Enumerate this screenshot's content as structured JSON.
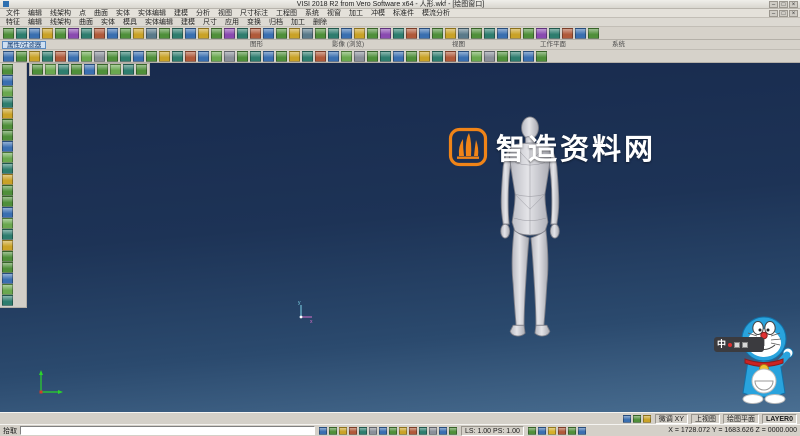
{
  "window": {
    "title": "VISI 2018 R2 from Vero Software x64 - 人形.wkf - [绘图窗口]",
    "controls": {
      "minimize": "–",
      "maximize": "□",
      "close": "×"
    }
  },
  "menus": {
    "main": [
      "文件",
      "编辑",
      "线架构",
      "点",
      "曲面",
      "实体",
      "实体编辑",
      "建模",
      "分析",
      "视图",
      "尺寸标注",
      "工程图",
      "系统",
      "视窗",
      "加工",
      "冲模",
      "标准件",
      "模流分析"
    ],
    "secondary": [
      "特征",
      "编辑",
      "线架构",
      "曲面",
      "实体",
      "模具",
      "实体编辑",
      "建模",
      "尺寸",
      "应用",
      "变换",
      "归档",
      "加工",
      "删除"
    ]
  },
  "toolbar": {
    "filter_tab": "属性/过滤器",
    "group_labels": [
      "图形",
      "影像 (浏览)",
      "视图",
      "工作平面",
      "系统"
    ],
    "row_a": {
      "count": 46,
      "size": 11,
      "name": "toolbar-icon",
      "palette": [
        "#4f8f3a",
        "#2e7d6e",
        "#3a6fb0",
        "#c9a227",
        "#4f8f3a",
        "#8a4ab0",
        "#2e7d6e",
        "#b05a3a",
        "#3a6fb0",
        "#4f8f3a",
        "#c9a227",
        "#5a7a8a"
      ]
    },
    "row_b": {
      "count": 42,
      "size": 11,
      "name": "toolbar-icon",
      "palette": [
        "#3a6fb0",
        "#4f8f3a",
        "#c9a227",
        "#2e7d6e",
        "#b05a3a",
        "#3a6fb0",
        "#6aa84f",
        "#8a8f98",
        "#4f8f3a",
        "#2e7d6e"
      ]
    },
    "row_c": {
      "count": 9,
      "size": 11,
      "name": "toolbar-icon",
      "palette": [
        "#4f8f3a",
        "#6aa84f",
        "#2e7d6e",
        "#4f8f3a",
        "#3a6fb0"
      ]
    },
    "left": {
      "count": 22,
      "size": 11,
      "name": "left-toolbar-icon",
      "palette": [
        "#4f8f3a",
        "#3a6fb0",
        "#6aa84f",
        "#2e7d6e",
        "#c9a227",
        "#4f8f3a"
      ]
    }
  },
  "viewport": {
    "watermark_text": "智造资料网",
    "watermark_accent": "#f08418"
  },
  "ime": {
    "label": "中"
  },
  "statusbar": {
    "upper_icons": {
      "count": 3,
      "size": 8,
      "name": "status-icon",
      "palette": [
        "#3a6fb0",
        "#4f8f3a",
        "#c9a227"
      ]
    },
    "snap_label": "微调 XY",
    "view_label": "上视图",
    "plane_label": "绘图平面",
    "layer": "LAYER0",
    "pick_label": "拾取",
    "scale": "LS: 1.00  PS: 1.00",
    "coords": "X = 1728.072   Y = 1683.626   Z = 0000.000",
    "lower_icons_1": {
      "count": 14,
      "size": 8,
      "name": "status-icon",
      "palette": [
        "#3a6fb0",
        "#4f8f3a",
        "#c9a227",
        "#b05a3a",
        "#2e7d6e",
        "#8a8f98"
      ]
    },
    "lower_icons_2": {
      "count": 6,
      "size": 8,
      "name": "status-icon",
      "palette": [
        "#4f8f3a",
        "#3a6fb0",
        "#d4b02a",
        "#b05a3a"
      ]
    }
  }
}
